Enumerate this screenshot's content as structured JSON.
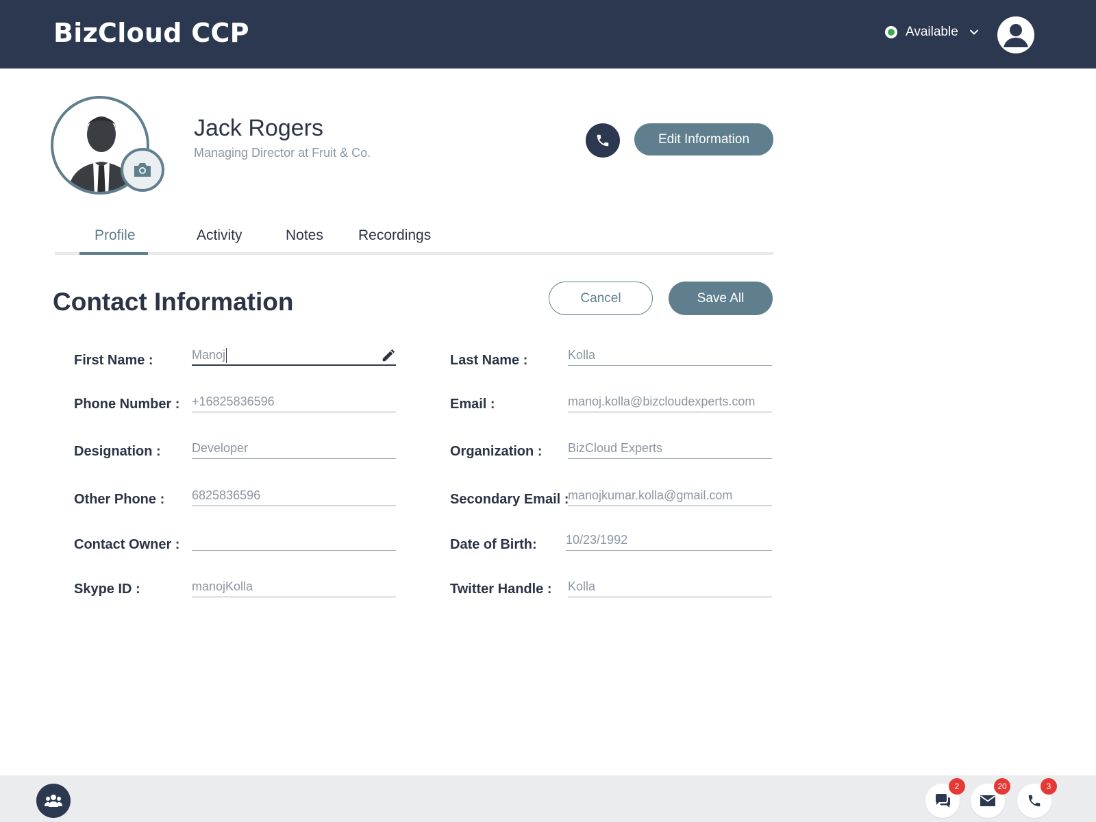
{
  "app": {
    "title": "BizCloud CCP"
  },
  "header": {
    "status_label": "Available",
    "status_color": "#3aaa4a",
    "status_icon": "chevron-down-icon",
    "avatar_icon": "user-avatar-icon"
  },
  "contact": {
    "name": "Jack Rogers",
    "subtitle": "Managing Director at Fruit & Co.",
    "edit_label": "Edit Information"
  },
  "tabs": [
    {
      "label": "Profile",
      "active": true
    },
    {
      "label": "Activity",
      "active": false
    },
    {
      "label": "Notes",
      "active": false
    },
    {
      "label": "Recordings",
      "active": false
    }
  ],
  "section": {
    "title": "Contact Information",
    "cancel_label": "Cancel",
    "save_label": "Save All"
  },
  "fields": {
    "first_name": {
      "label": "First Name :",
      "value": "Manoj"
    },
    "last_name": {
      "label": "Last Name :",
      "value": "Kolla"
    },
    "phone": {
      "label": "Phone Number :",
      "value": "+16825836596"
    },
    "email": {
      "label": "Email :",
      "value": "manoj.kolla@bizcloudexperts.com"
    },
    "designation": {
      "label": "Designation :",
      "value": "Developer"
    },
    "organization": {
      "label": "Organization :",
      "value": "BizCloud Experts"
    },
    "other_phone": {
      "label": "Other Phone :",
      "value": "6825836596"
    },
    "secondary_email": {
      "label": "Secondary Email :",
      "value": "manojkumar.kolla@gmail.com"
    },
    "contact_owner": {
      "label": "Contact Owner :",
      "value": ""
    },
    "dob": {
      "label": "Date of Birth:",
      "value": "10/23/1992"
    },
    "skype": {
      "label": "Skype ID :",
      "value": "manojKolla"
    },
    "twitter": {
      "label": "Twitter Handle :",
      "value": "Kolla"
    }
  },
  "footer": {
    "chat_count": "2",
    "mail_count": "20",
    "call_count": "3",
    "badge_color": "#e53935"
  },
  "colors": {
    "header_bg": "#2c3850",
    "accent": "#5f7f8e",
    "footer_bg": "#ebecee"
  }
}
